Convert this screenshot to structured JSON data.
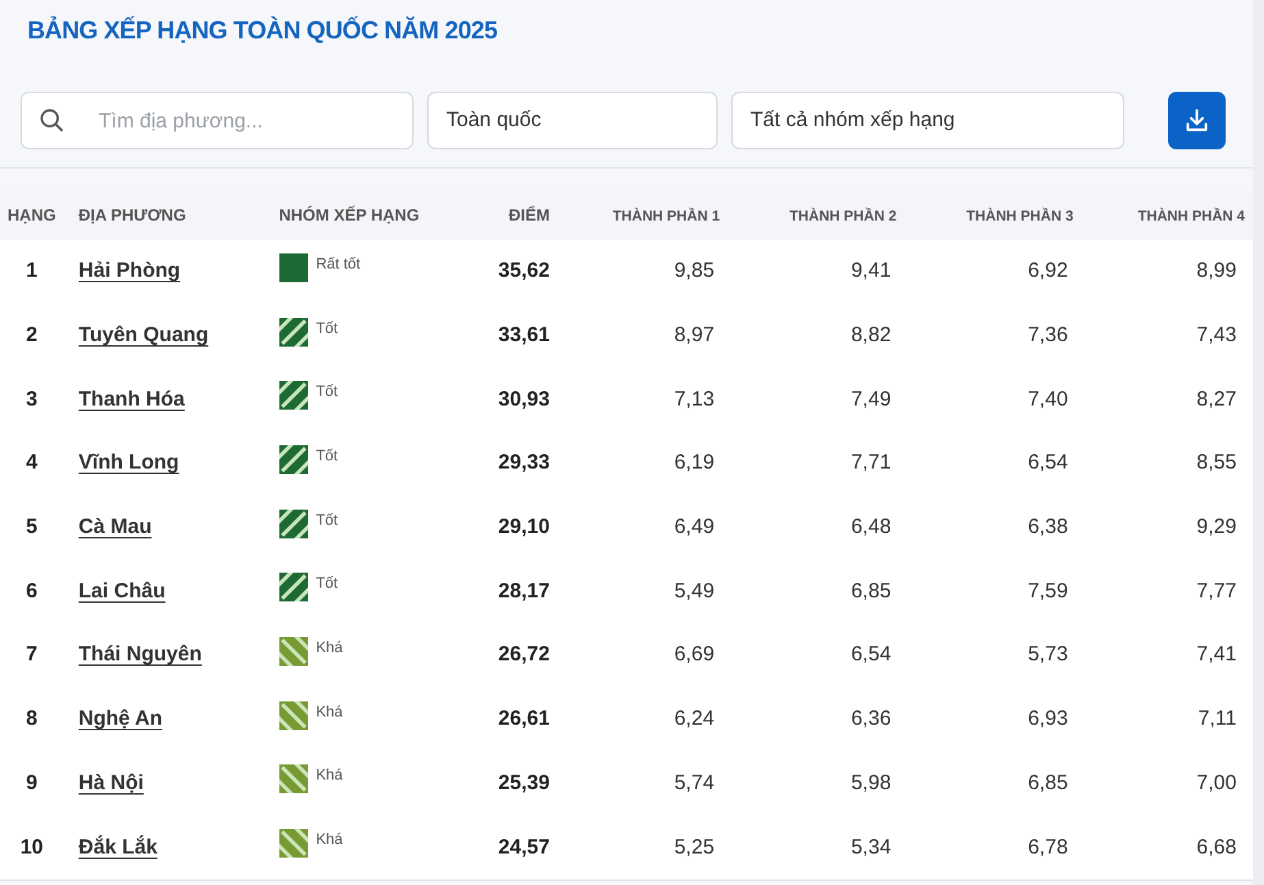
{
  "title": "BẢNG XẾP HẠNG TOÀN QUỐC NĂM 2025",
  "filters": {
    "search": {
      "placeholder": "Tìm địa phương..."
    },
    "region": "Toàn quốc",
    "group": "Tất cả nhóm xếp hạng"
  },
  "table": {
    "columns": [
      "HẠNG",
      "ĐỊA PHƯƠNG",
      "NHÓM XẾP HẠNG",
      "ĐIỂM",
      "THÀNH PHẦN 1",
      "THÀNH PHẦN 2",
      "THÀNH PHẦN 3",
      "THÀNH PHẦN 4"
    ],
    "rows": [
      {
        "rank": "1",
        "name": "Hải Phòng",
        "group": {
          "label": "Rất tốt",
          "kind": "solid",
          "color": "#1d6a36"
        },
        "score": "35,62",
        "parts": [
          "9,85",
          "9,41",
          "6,92",
          "8,99"
        ]
      },
      {
        "rank": "2",
        "name": "Tuyên Quang",
        "group": {
          "label": "Tốt",
          "kind": "forward",
          "color": "#1d6a36"
        },
        "score": "33,61",
        "parts": [
          "8,97",
          "8,82",
          "7,36",
          "7,43"
        ]
      },
      {
        "rank": "3",
        "name": "Thanh Hóa",
        "group": {
          "label": "Tốt",
          "kind": "forward",
          "color": "#1d6a36"
        },
        "score": "30,93",
        "parts": [
          "7,13",
          "7,49",
          "7,40",
          "8,27"
        ]
      },
      {
        "rank": "4",
        "name": "Vĩnh Long",
        "group": {
          "label": "Tốt",
          "kind": "forward",
          "color": "#1d6a36"
        },
        "score": "29,33",
        "parts": [
          "6,19",
          "7,71",
          "6,54",
          "8,55"
        ]
      },
      {
        "rank": "5",
        "name": "Cà Mau",
        "group": {
          "label": "Tốt",
          "kind": "forward",
          "color": "#1d6a36"
        },
        "score": "29,10",
        "parts": [
          "6,49",
          "6,48",
          "6,38",
          "9,29"
        ]
      },
      {
        "rank": "6",
        "name": "Lai Châu",
        "group": {
          "label": "Tốt",
          "kind": "forward",
          "color": "#1d6a36"
        },
        "score": "28,17",
        "parts": [
          "5,49",
          "6,85",
          "7,59",
          "7,77"
        ]
      },
      {
        "rank": "7",
        "name": "Thái Nguyên",
        "group": {
          "label": "Khá",
          "kind": "back",
          "color": "#789a32"
        },
        "score": "26,72",
        "parts": [
          "6,69",
          "6,54",
          "5,73",
          "7,41"
        ]
      },
      {
        "rank": "8",
        "name": "Nghệ An",
        "group": {
          "label": "Khá",
          "kind": "back",
          "color": "#789a32"
        },
        "score": "26,61",
        "parts": [
          "6,24",
          "6,36",
          "6,93",
          "7,11"
        ]
      },
      {
        "rank": "9",
        "name": "Hà Nội",
        "group": {
          "label": "Khá",
          "kind": "back",
          "color": "#789a32"
        },
        "score": "25,39",
        "parts": [
          "5,74",
          "5,98",
          "6,85",
          "7,00"
        ]
      },
      {
        "rank": "10",
        "name": "Đắk Lắk",
        "group": {
          "label": "Khá",
          "kind": "back",
          "color": "#789a32"
        },
        "score": "24,57",
        "parts": [
          "5,25",
          "5,34",
          "6,78",
          "6,68"
        ]
      }
    ]
  }
}
